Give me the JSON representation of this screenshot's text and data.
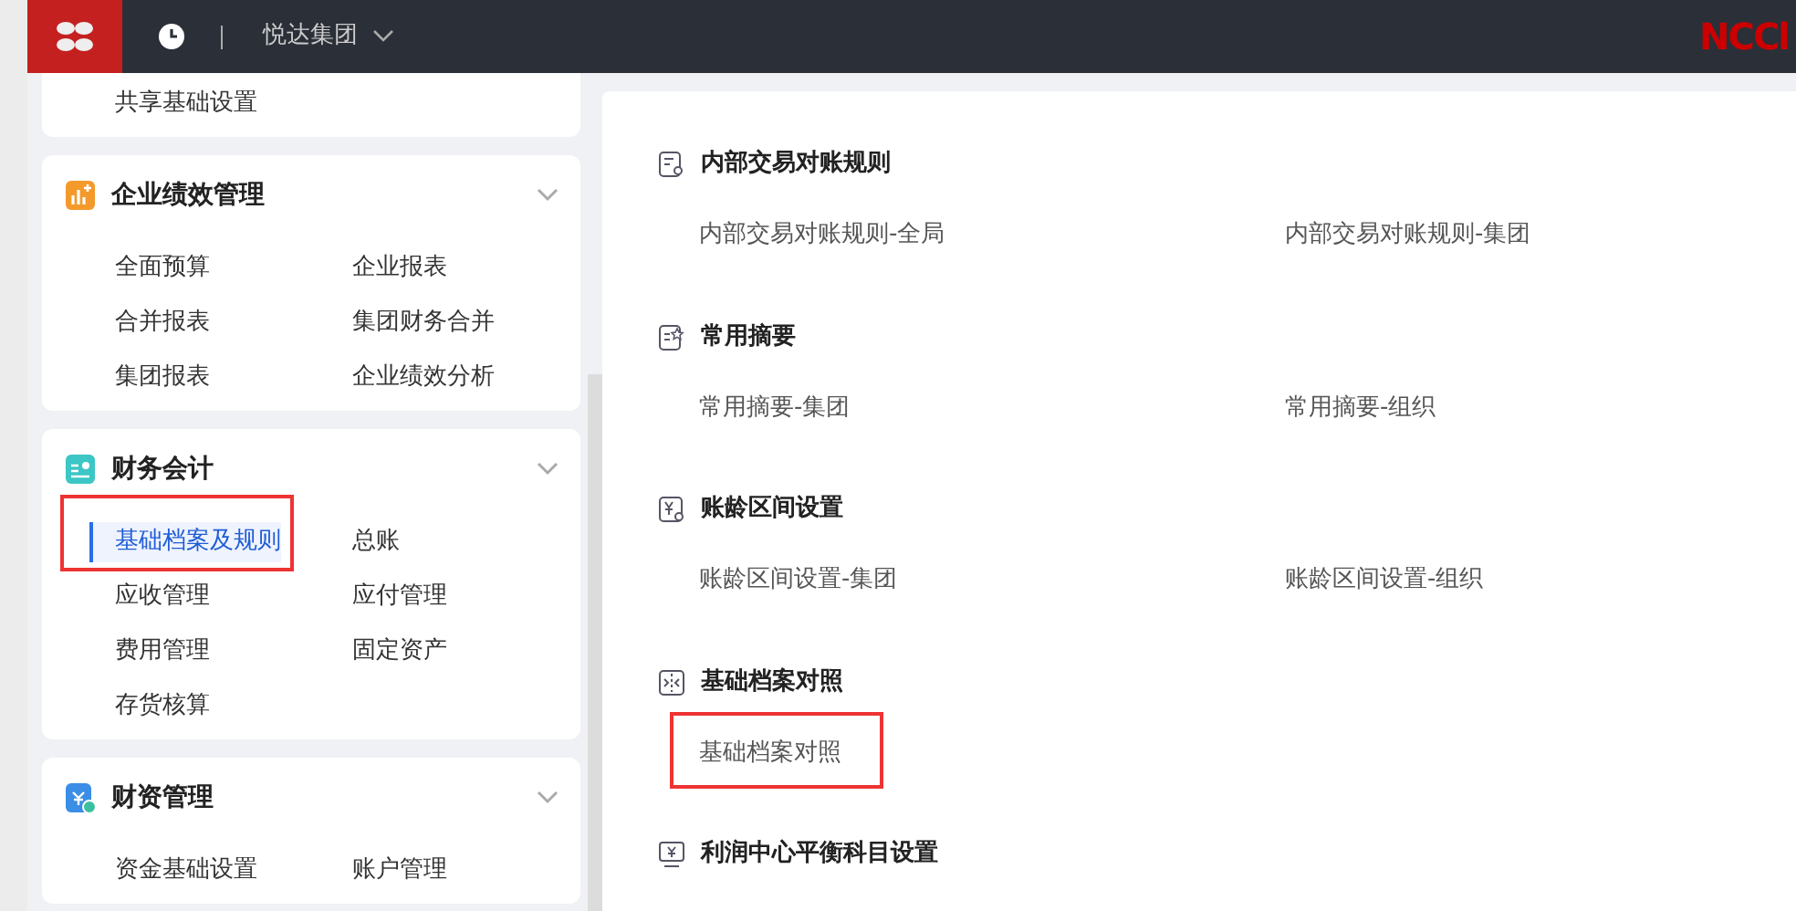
{
  "topbar": {
    "org": "悦达集团",
    "brand": "NCCl"
  },
  "sidebar": {
    "groups": [
      {
        "items": [
          {
            "label": "共享基础设置",
            "selected": false,
            "annotated": false
          }
        ]
      },
      {
        "title": "企业绩效管理",
        "expanded": true,
        "items": [
          {
            "label": "全面预算",
            "selected": false,
            "annotated": false
          },
          {
            "label": "企业报表",
            "selected": false,
            "annotated": false
          },
          {
            "label": "合并报表",
            "selected": false,
            "annotated": false
          },
          {
            "label": "集团财务合并",
            "selected": false,
            "annotated": false
          },
          {
            "label": "集团报表",
            "selected": false,
            "annotated": false
          },
          {
            "label": "企业绩效分析",
            "selected": false,
            "annotated": false
          }
        ]
      },
      {
        "title": "财务会计",
        "expanded": true,
        "items": [
          {
            "label": "基础档案及规则",
            "selected": true,
            "annotated": true
          },
          {
            "label": "总账",
            "selected": false,
            "annotated": false
          },
          {
            "label": "应收管理",
            "selected": false,
            "annotated": false
          },
          {
            "label": "应付管理",
            "selected": false,
            "annotated": false
          },
          {
            "label": "费用管理",
            "selected": false,
            "annotated": false
          },
          {
            "label": "固定资产",
            "selected": false,
            "annotated": false
          },
          {
            "label": "存货核算",
            "selected": false,
            "annotated": false
          }
        ]
      },
      {
        "title": "财资管理",
        "expanded": true,
        "items": [
          {
            "label": "资金基础设置",
            "selected": false,
            "annotated": false
          },
          {
            "label": "账户管理",
            "selected": false,
            "annotated": false
          }
        ]
      }
    ]
  },
  "content": {
    "sections": [
      {
        "title": "内部交易对账规则",
        "links": [
          {
            "label": "内部交易对账规则-全局",
            "annotated": false
          },
          {
            "label": "内部交易对账规则-集团",
            "annotated": false
          }
        ]
      },
      {
        "title": "常用摘要",
        "links": [
          {
            "label": "常用摘要-集团",
            "annotated": false
          },
          {
            "label": "常用摘要-组织",
            "annotated": false
          }
        ]
      },
      {
        "title": "账龄区间设置",
        "links": [
          {
            "label": "账龄区间设置-集团",
            "annotated": false
          },
          {
            "label": "账龄区间设置-组织",
            "annotated": false
          }
        ]
      },
      {
        "title": "基础档案对照",
        "links": [
          {
            "label": "基础档案对照",
            "annotated": true
          }
        ]
      },
      {
        "title": "利润中心平衡科目设置"
      }
    ]
  }
}
